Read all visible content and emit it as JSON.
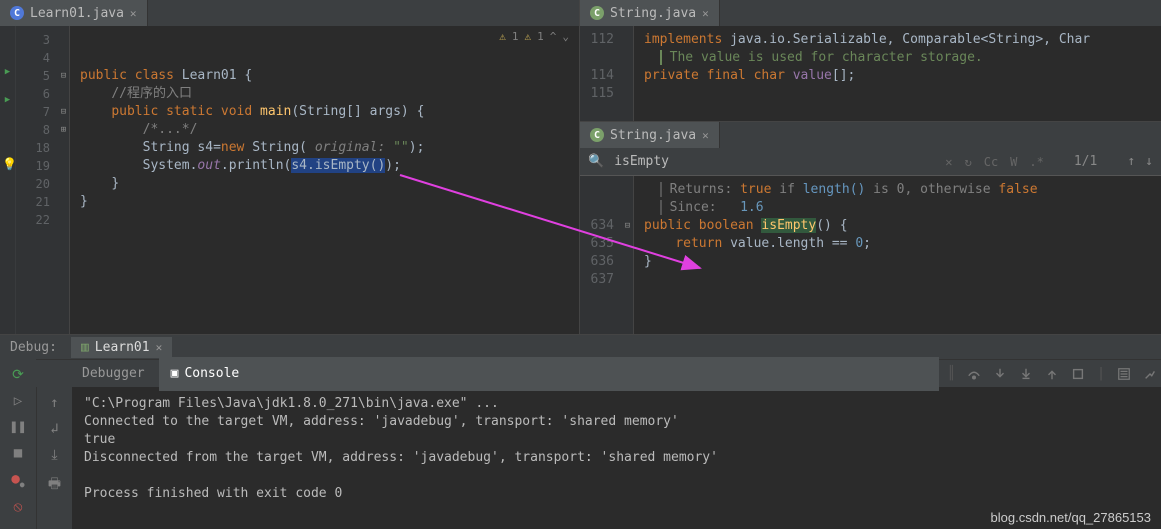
{
  "left": {
    "tab_label": "Learn01.java",
    "lines": [
      "3",
      "4",
      "5",
      "6",
      "7",
      "8",
      "18",
      "19",
      "20",
      "21",
      "22"
    ],
    "code": {
      "l5a": "public",
      "l5b": "class",
      "l5c": "Learn01",
      "l6": "//程序的入口",
      "l7a": "public",
      "l7b": "static",
      "l7c": "void",
      "l7d": "main",
      "l7e": "(String[] args) {",
      "l8": "/*...*/",
      "l18a": "String s4=",
      "l18b": "new",
      "l18c": "String(",
      "l18d": " original: ",
      "l18e": "\"\"",
      "l18f": ");",
      "l19a": "System.",
      "l19b": "out",
      "l19c": ".println(",
      "l19d": "s4.isEmpty()",
      "l19e": ");",
      "l20": "}",
      "l21": "}"
    },
    "inspect": {
      "w1": "1",
      "w2": "1"
    }
  },
  "right_top": {
    "tab_label": "String.java",
    "lines": [
      "112",
      "",
      "114",
      "115"
    ],
    "l112a": "implements",
    "l112b": " java.io.Serializable, Comparable<String>, Char",
    "doc": "The value is used for character storage.",
    "l114a": "private",
    "l114b": "final",
    "l114c": "char",
    "l114d": "value",
    "l114e": "[];"
  },
  "right_bot": {
    "tab_label": "String.java",
    "search_term": "isEmpty",
    "search_count": "1/1",
    "doc_ret_a": "Returns:",
    "doc_ret_b": "true",
    "doc_ret_c": " if ",
    "doc_ret_d": "length()",
    "doc_ret_e": " is 0, otherwise ",
    "doc_ret_f": "false",
    "doc_since_a": "Since:",
    "doc_since_b": "1.6",
    "lines": [
      "634",
      "635",
      "636",
      "637"
    ],
    "l634a": "public",
    "l634b": "boolean",
    "l634c": "isEmpty",
    "l634d": "() {",
    "l635a": "return",
    "l635b": " value.length == ",
    "l635c": "0",
    "l635d": ";",
    "l636": "}"
  },
  "debug": {
    "title": "Debug:",
    "run_tab": "Learn01",
    "subtabs": {
      "debugger": "Debugger",
      "console": "Console"
    },
    "out1": "\"C:\\Program Files\\Java\\jdk1.8.0_271\\bin\\java.exe\" ...",
    "out2": "Connected to the target VM, address: 'javadebug', transport: 'shared memory'",
    "out3": "true",
    "out4": "Disconnected from the target VM, address: 'javadebug', transport: 'shared memory'",
    "out5": "",
    "out6": "Process finished with exit code 0"
  },
  "watermark": "blog.csdn.net/qq_27865153"
}
